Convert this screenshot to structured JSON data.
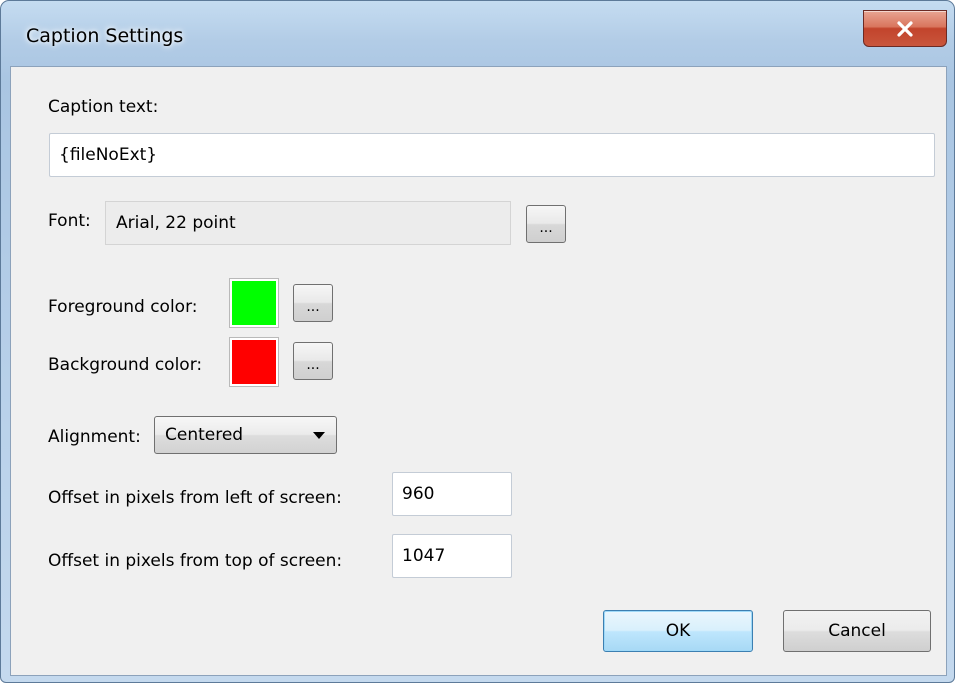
{
  "window": {
    "title": "Caption Settings",
    "close_glyph": "x"
  },
  "caption": {
    "label": "Caption text:",
    "value": "{fileNoExt}"
  },
  "font": {
    "label": "Font:",
    "value": "Arial, 22 point",
    "browse_label": "..."
  },
  "foreground": {
    "label": "Foreground color:",
    "color": "#00ff00",
    "browse_label": "..."
  },
  "background": {
    "label": "Background color:",
    "color": "#ff0000",
    "browse_label": "..."
  },
  "alignment": {
    "label": "Alignment:",
    "selected": "Centered"
  },
  "offset_left": {
    "label": "Offset in pixels from left of screen:",
    "value": "960"
  },
  "offset_top": {
    "label": "Offset in pixels from top of screen:",
    "value": "1047"
  },
  "buttons": {
    "ok_label": "OK",
    "cancel_label": "Cancel"
  }
}
